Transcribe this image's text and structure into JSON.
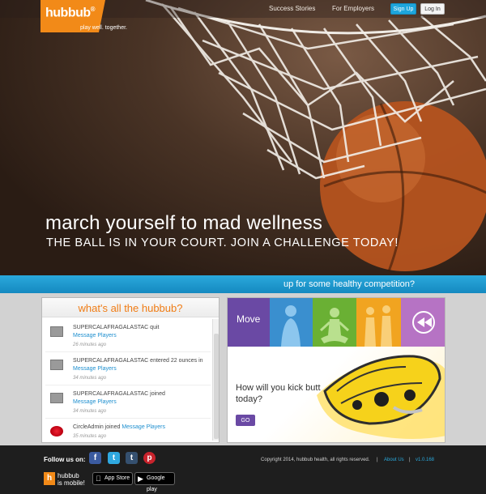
{
  "brand": {
    "logo": "hubbub",
    "tagline": "play well. together."
  },
  "nav": {
    "stories": "Success Stories",
    "employers": "For Employers",
    "signup": "Sign Up",
    "login": "Log In"
  },
  "hero": {
    "headline": "march yourself to mad wellness",
    "subheadline": "THE BALL IS IN YOUR COURT. JOIN A CHALLENGE TODAY!"
  },
  "strip": {
    "text": "up for some healthy competition?"
  },
  "feed": {
    "title": "what's all the hubbub?",
    "items": [
      {
        "before": "SUPERCALAFRAGALASTAC quit",
        "link": "Message Players",
        "after": "",
        "time": "26 minutes ago",
        "icon": "shoe-icon"
      },
      {
        "before": "SUPERCALAFRAGALASTAC entered 22 ounces in",
        "link": "Message Players",
        "after": "",
        "time": "34 minutes ago",
        "icon": "shoe-icon"
      },
      {
        "before": "SUPERCALAFRAGALASTAC joined",
        "link": "Message Players",
        "after": "",
        "time": "34 minutes ago",
        "icon": "shoe-icon"
      },
      {
        "before": "CircleAdmin joined",
        "link": "Message Players",
        "after": "",
        "time": "35 minutes ago",
        "icon": "red-avatar-icon"
      }
    ]
  },
  "promo": {
    "tile_label": "Move",
    "question": "How will you kick butt today?",
    "go": "GO"
  },
  "footer": {
    "follow": "Follow us on:",
    "mobile_line1": "hubbub",
    "mobile_line2": "is mobile!",
    "appstore": "App Store",
    "googleplay": "Google play",
    "copyright": "Copyright 2014, hubbub health, all rights reserved.",
    "sep": "|",
    "about": "About Us",
    "version": "v1.0.168"
  },
  "colors": {
    "accent_orange": "#f28a18",
    "accent_blue": "#1ea6dc",
    "purple": "#6a49a4"
  }
}
